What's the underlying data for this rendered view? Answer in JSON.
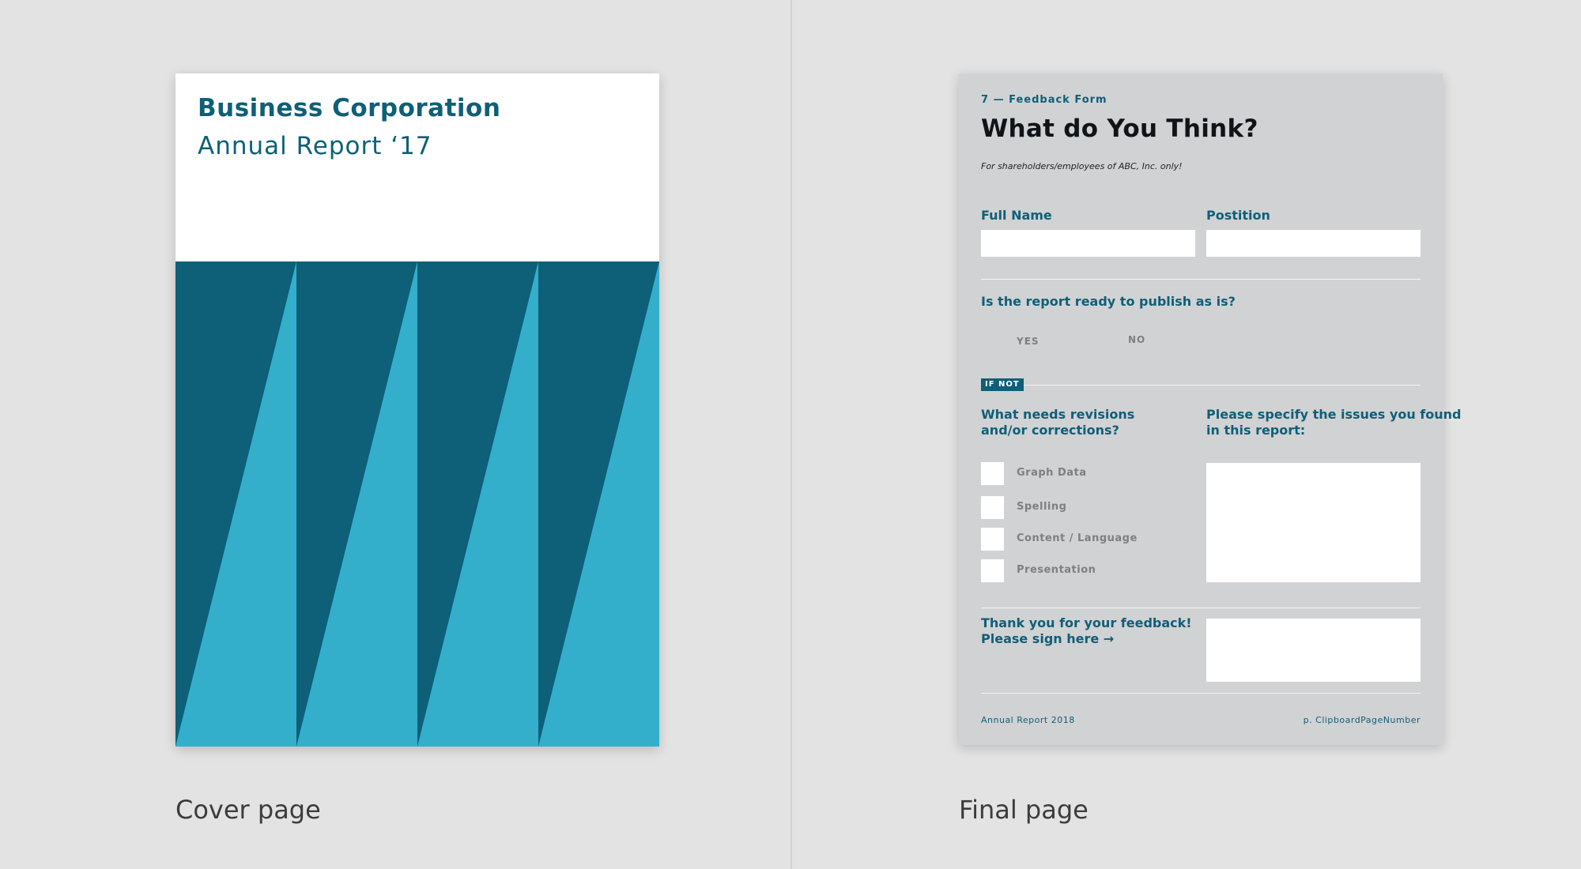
{
  "cover": {
    "company": "Business Corporation",
    "subtitle": "Annual Report ‘17",
    "caption": "Cover page",
    "colors": {
      "dark": "#0e5f78",
      "light": "#33afcc"
    }
  },
  "final": {
    "caption": "Final page",
    "section": "7 — Feedback Form",
    "title": "What do You Think?",
    "note": "For shareholders/employees of ABC, Inc. only!",
    "full_name_label": "Full Name",
    "position_label": "Postition",
    "question": "Is the report ready to publish as is?",
    "yes": "YES",
    "no": "NO",
    "if_not": "IF NOT",
    "revisions_label_1": "What needs revisions",
    "revisions_label_2": "and/or corrections?",
    "issues_label_1": "Please specify the issues you found",
    "issues_label_2": "in this report:",
    "checkboxes": [
      "Graph Data",
      "Spelling",
      "Content / Language",
      "Presentation"
    ],
    "thanks_1": "Thank you for your feedback!",
    "thanks_2": "Please sign here →",
    "footer_left": "Annual Report 2018",
    "footer_right": "p. ClipboardPageNumber"
  }
}
